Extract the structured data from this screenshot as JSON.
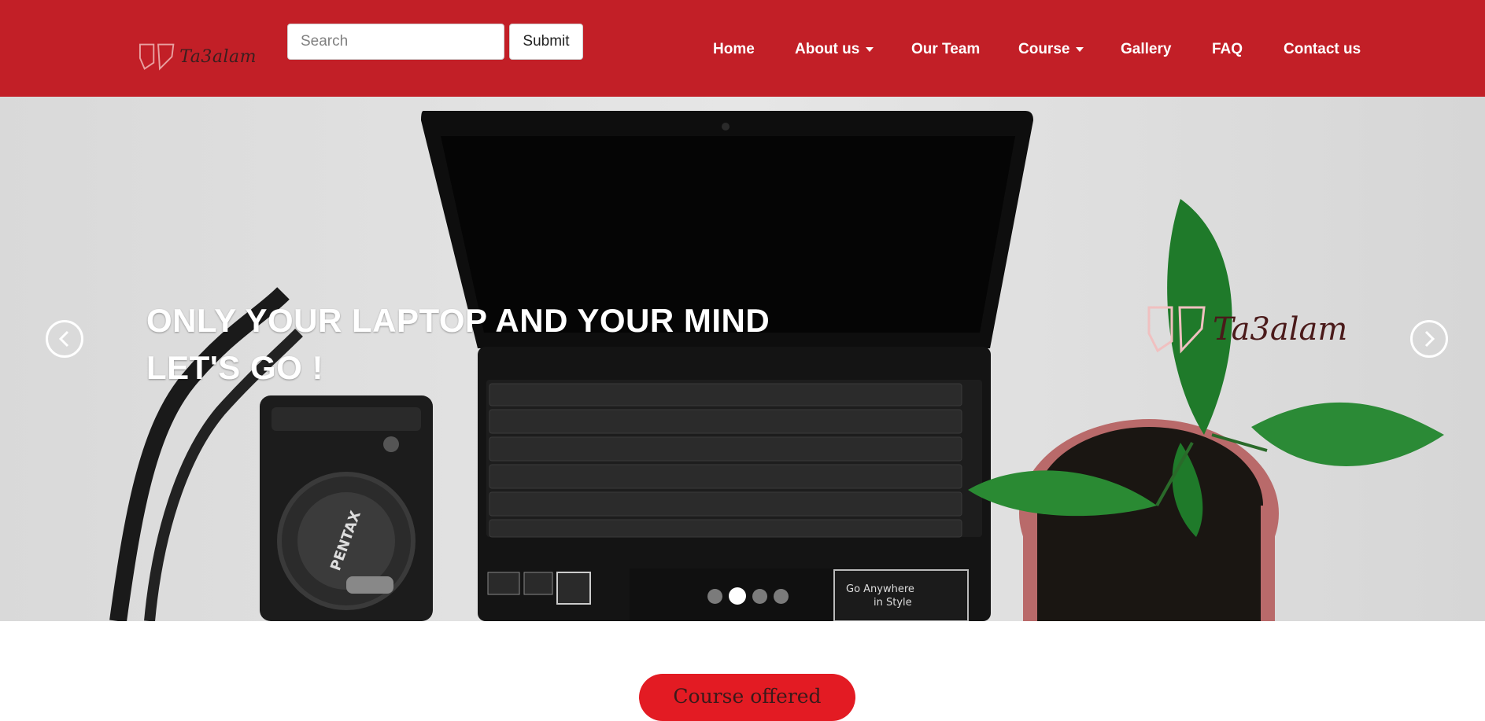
{
  "brand": {
    "name": "Ta3alam"
  },
  "header": {
    "search_placeholder": "Search",
    "submit_label": "Submit",
    "background_color": "#c21f27"
  },
  "nav": {
    "items": [
      {
        "label": "Home",
        "has_dropdown": false
      },
      {
        "label": "About us",
        "has_dropdown": true
      },
      {
        "label": "Our Team",
        "has_dropdown": false
      },
      {
        "label": "Course",
        "has_dropdown": true
      },
      {
        "label": "Gallery",
        "has_dropdown": false
      },
      {
        "label": "FAQ",
        "has_dropdown": false
      },
      {
        "label": "Contact us",
        "has_dropdown": false
      }
    ]
  },
  "hero": {
    "caption_line1": "ONLY YOUR LAPTOP AND YOUR MIND",
    "caption_line2": "LET'S GO !",
    "logo_text": "Ta3alam",
    "prev_icon": "chevron-left-icon",
    "next_icon": "chevron-right-icon",
    "slide_count": 4,
    "active_slide": 2
  },
  "section": {
    "course_offered_label": "Course offered",
    "accent_color": "#e31b23"
  }
}
